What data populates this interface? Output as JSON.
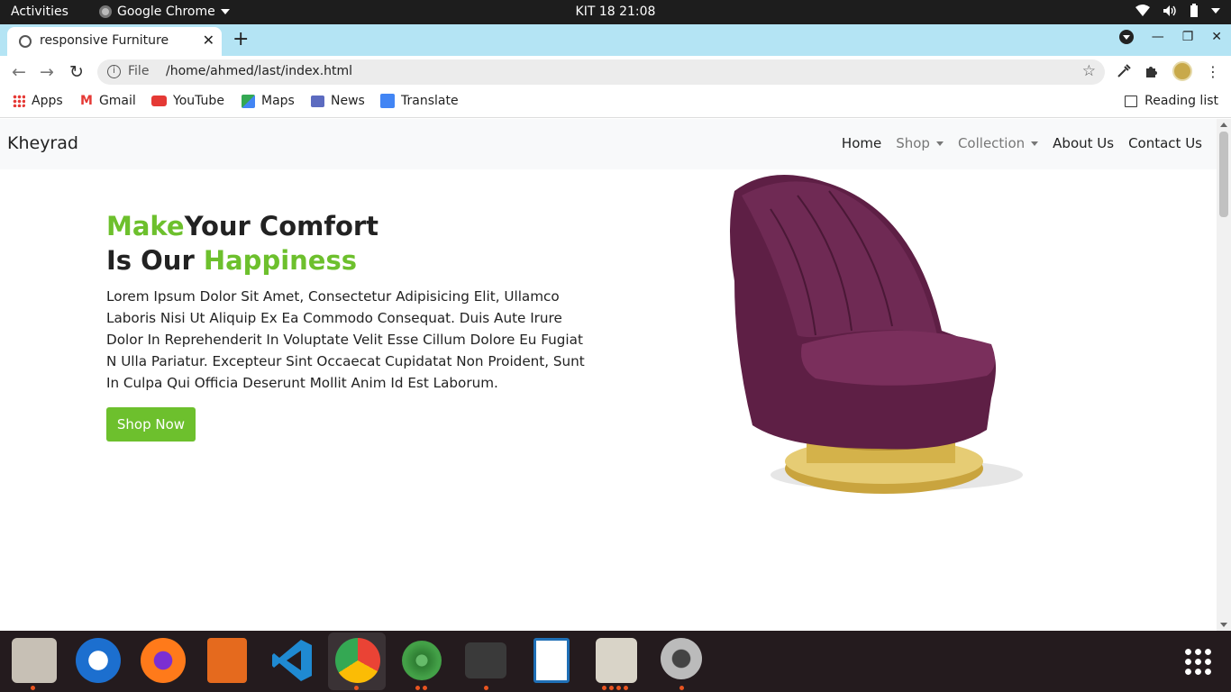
{
  "system_bar": {
    "activities": "Activities",
    "app_menu": "Google Chrome",
    "clock": "KIT 18  21:08"
  },
  "browser": {
    "tab_title": "responsive Furniture",
    "address_scheme": "File",
    "address_url": "/home/ahmed/last/index.html",
    "bookmarks": [
      "Apps",
      "Gmail",
      "YouTube",
      "Maps",
      "News",
      "Translate"
    ],
    "reading_list": "Reading list"
  },
  "site": {
    "brand": "Kheyrad",
    "nav": [
      "Home",
      "Shop",
      "Collection",
      "About Us",
      "Contact Us"
    ],
    "hero": {
      "title_green_1": "Make",
      "title_dark_1": "Your Comfort",
      "title_dark_2": "Is Our ",
      "title_green_2": "Happiness",
      "text": "Lorem Ipsum Dolor Sit Amet, Consectetur Adipisicing Elit, Ullamco Laboris Nisi Ut Aliquip Ex Ea Commodo Consequat. Duis Aute Irure Dolor In Reprehenderit In Voluptate Velit Esse Cillum Dolore Eu Fugiat N Ulla Pariatur. Excepteur Sint Occaecat Cupidatat Non Proident, Sunt In Culpa Qui Officia Deserunt Mollit Anim Id Est Laborum.",
      "button": "Shop Now"
    },
    "colors": {
      "accent": "#6dc02d",
      "navbar_bg": "#f8f9fa",
      "chair": "#5e1f45",
      "chair_base": "#d4b24a"
    }
  },
  "dock": {
    "icons": [
      "files-icon",
      "thunderbird-icon",
      "firefox-icon",
      "impress-icon",
      "vscode-icon",
      "chrome-icon",
      "atom-icon",
      "terminal-icon",
      "writer-icon",
      "image-viewer-icon",
      "settings-icon",
      "show-apps-icon"
    ]
  }
}
